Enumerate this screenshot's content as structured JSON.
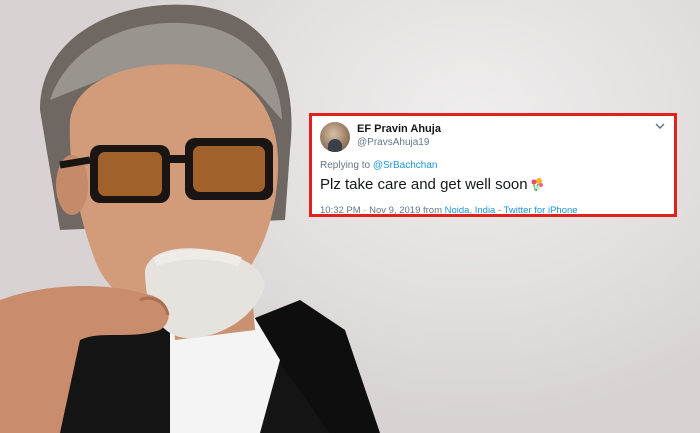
{
  "tweet": {
    "display_name": "EF Pravin Ahuja",
    "handle": "@PravsAhuja19",
    "replying_prefix": "Replying to ",
    "replying_to": "@SrBachchan",
    "text": "Plz take care and get well soon",
    "time": "10:32 PM",
    "separator": " · ",
    "date": "Nov 9, 2019",
    "from_word": " from ",
    "location": "Noida, India",
    "dash": " - ",
    "source": "Twitter for iPhone",
    "caret_icon": "chevron-down-icon",
    "emoji_icon": "flower-bouquet-icon"
  },
  "colors": {
    "highlight_border": "#e0211e",
    "link": "#1b95e0",
    "muted": "#657786",
    "text": "#14171a"
  }
}
